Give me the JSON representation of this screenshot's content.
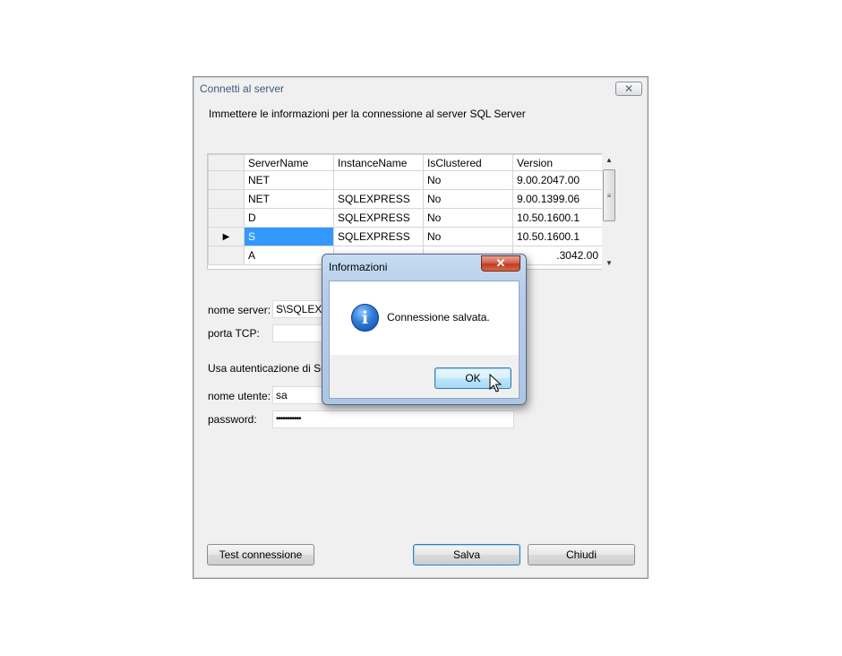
{
  "window": {
    "title": "Connetti al server",
    "close_glyph": "✕",
    "intro": "Immettere le informazioni per la connessione al server SQL Server"
  },
  "grid": {
    "columns": [
      "ServerName",
      "InstanceName",
      "IsClustered",
      "Version"
    ],
    "rows": [
      {
        "indicator": "",
        "cells": [
          "NET",
          "",
          "No",
          "9.00.2047.00"
        ]
      },
      {
        "indicator": "",
        "cells": [
          "NET",
          "SQLEXPRESS",
          "No",
          "9.00.1399.06"
        ]
      },
      {
        "indicator": "",
        "cells": [
          "D",
          "SQLEXPRESS",
          "No",
          "10.50.1600.1"
        ]
      },
      {
        "indicator": "▶",
        "cells": [
          "S",
          "SQLEXPRESS",
          "No",
          "10.50.1600.1"
        ],
        "selected": true
      },
      {
        "indicator": "",
        "cells": [
          "A",
          "",
          "",
          ".3042.00"
        ]
      }
    ]
  },
  "form": {
    "server_label": "nome server:",
    "server_value": "S\\SQLEXP",
    "port_label": "porta TCP:",
    "port_value": "",
    "auth_label": "Usa autenticazione di SQL",
    "user_label": "nome utente:",
    "user_value": "sa",
    "password_label": "password:",
    "password_value": "•••••••••••"
  },
  "buttons": {
    "test": "Test connessione",
    "save": "Salva",
    "close": "Chiudi"
  },
  "message_box": {
    "title": "Informazioni",
    "close_glyph": "✕",
    "icon": "info-icon",
    "icon_glyph": "i",
    "text": "Connessione salvata.",
    "ok": "OK"
  }
}
